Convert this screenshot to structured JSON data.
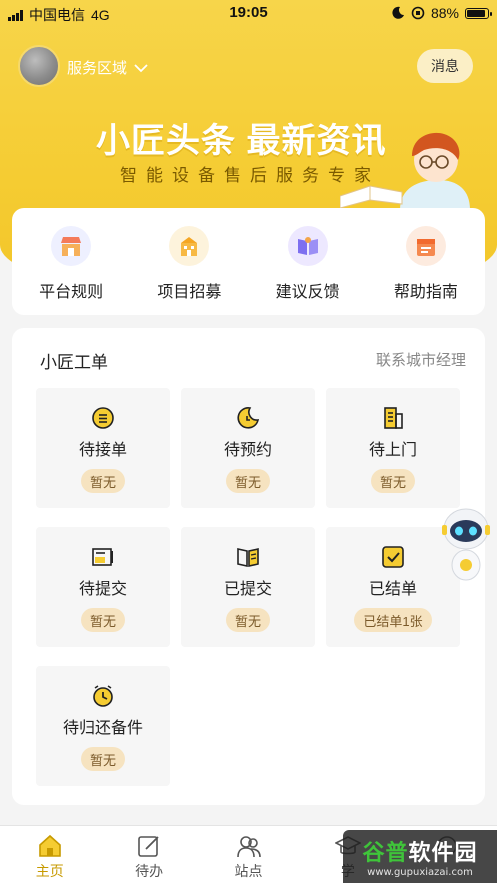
{
  "status_bar": {
    "carrier": "中国电信",
    "network": "4G",
    "time": "19:05",
    "battery": "88%",
    "battery_level": 0.88
  },
  "header": {
    "region_label": "服务区域",
    "message_button": "消息"
  },
  "banner": {
    "headline": "小匠头条 最新资讯",
    "subline": "智能设备售后服务专家"
  },
  "quick_links": [
    {
      "label": "平台规则",
      "icon": "shop-icon",
      "bg": "#eef0ff"
    },
    {
      "label": "项目招募",
      "icon": "building-icon",
      "bg": "#fdf3dc"
    },
    {
      "label": "建议反馈",
      "icon": "book-feedback-icon",
      "bg": "#ede8ff"
    },
    {
      "label": "帮助指南",
      "icon": "calendar-guide-icon",
      "bg": "#fdebdf"
    }
  ],
  "orders": {
    "title": "小匠工单",
    "contact_link": "联系城市经理",
    "tiles": [
      {
        "label": "待接单",
        "badge": "暂无",
        "icon": "list-circle-icon"
      },
      {
        "label": "待预约",
        "badge": "暂无",
        "icon": "moon-icon"
      },
      {
        "label": "待上门",
        "badge": "暂无",
        "icon": "door-building-icon"
      },
      {
        "label": "待提交",
        "badge": "暂无",
        "icon": "submit-card-icon"
      },
      {
        "label": "已提交",
        "badge": "暂无",
        "icon": "open-book-icon"
      },
      {
        "label": "已结单",
        "badge": "已结单1张",
        "icon": "checkbox-icon"
      },
      {
        "label": "待归还备件",
        "badge": "暂无",
        "icon": "clock-icon"
      }
    ]
  },
  "tab_bar": [
    {
      "label": "主页",
      "icon": "home-icon",
      "active": true
    },
    {
      "label": "待办",
      "icon": "edit-icon",
      "active": false
    },
    {
      "label": "站点",
      "icon": "people-icon",
      "active": false
    },
    {
      "label": "学",
      "icon": "graduation-icon",
      "active": false
    },
    {
      "label": "",
      "icon": "more-icon",
      "active": false
    }
  ],
  "watermark": {
    "brand_a": "谷普",
    "brand_b": "软件园",
    "url": "www.gupuxiazai.com"
  },
  "colors": {
    "primary_yellow": "#f5cc32",
    "accent_gold": "#c79a00",
    "badge_bg": "#f6e3c0",
    "badge_text": "#7b5a2a"
  }
}
